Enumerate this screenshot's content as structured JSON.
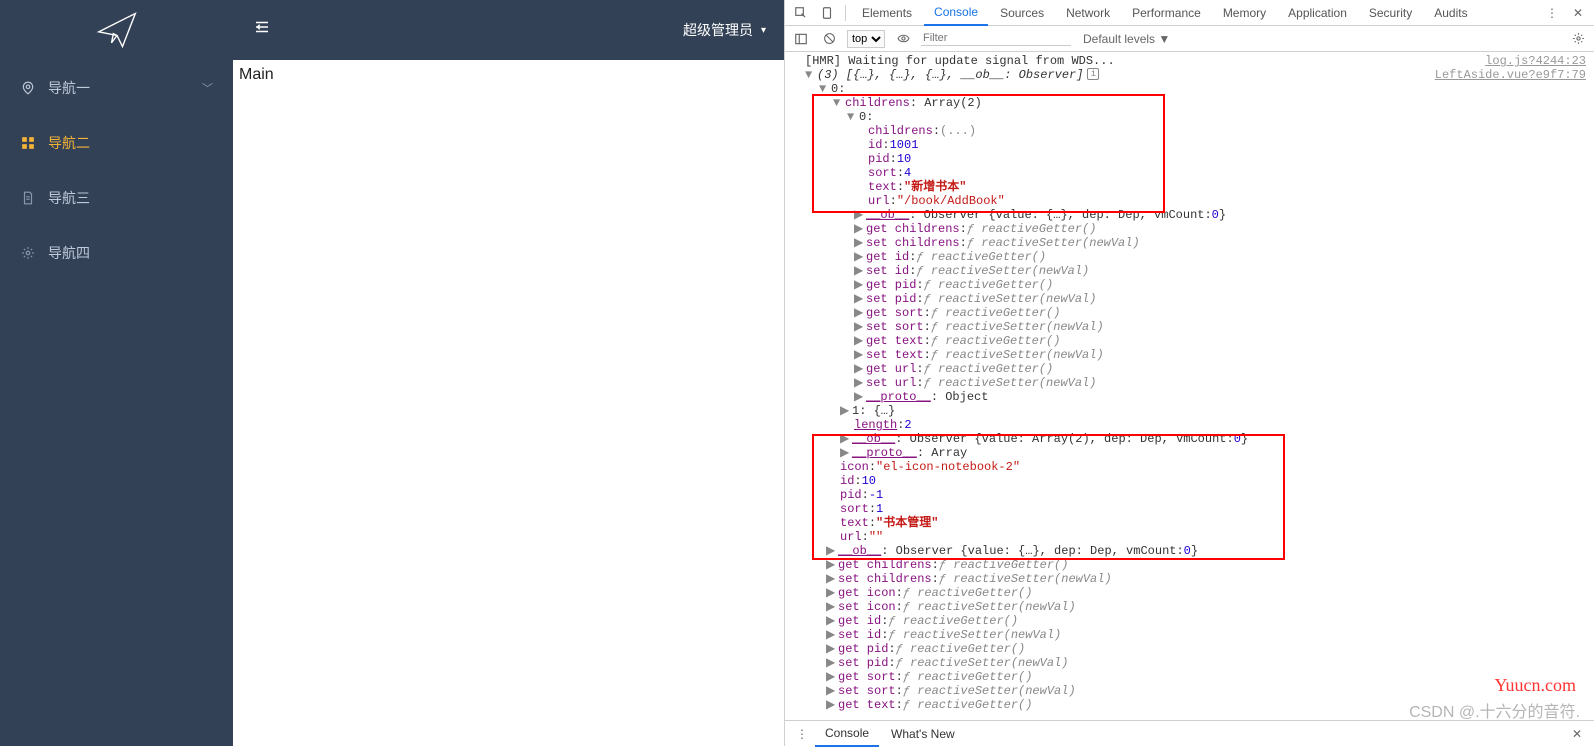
{
  "sidebar": {
    "items": [
      {
        "label": "导航一",
        "icon": "location-icon",
        "hasChildren": true
      },
      {
        "label": "导航二",
        "icon": "grid-icon",
        "active": true
      },
      {
        "label": "导航三",
        "icon": "document-icon"
      },
      {
        "label": "导航四",
        "icon": "gear-icon"
      }
    ]
  },
  "topbar": {
    "user": "超级管理员"
  },
  "main": {
    "text": "Main"
  },
  "devtools": {
    "tabs": [
      "Elements",
      "Console",
      "Sources",
      "Network",
      "Performance",
      "Memory",
      "Application",
      "Security",
      "Audits"
    ],
    "activeTab": "Console",
    "context": "top",
    "filterPlaceholder": "Filter",
    "levels": "Default levels ▼",
    "drawerTabs": [
      "Console",
      "What's New"
    ],
    "drawerActive": "Console"
  },
  "console": {
    "hmr": "[HMR] Waiting for update signal from WDS...",
    "hmrSrc": "log.js?4244:23",
    "arrSummary": "(3) [{…}, {…}, {…}, __ob__: Observer]",
    "arrSrc": "LeftAside.vue?e9f7:79",
    "idx0": "0:",
    "childrensArr": "childrens: Array(2)",
    "innerIdx0": "0:",
    "childrensEllipsis": "childrens: (...)",
    "id1001_key": "id: ",
    "id1001_val": "1001",
    "pid10_key": "pid: ",
    "pid10_val": "10",
    "sort4_key": "sort: ",
    "sort4_val": "4",
    "text_key": "text: ",
    "text_xinzeng": "\"新增书本\"",
    "url_key": "url: ",
    "url_addbook": "\"/book/AddBook\"",
    "ob_observer_line": "__ob__: Observer {value: {…}, dep: Dep, vmCount: 0}",
    "get_childrens": "get childrens: ƒ reactiveGetter()",
    "set_childrens": "set childrens: ƒ reactiveSetter(newVal)",
    "get_id": "get id: ƒ reactiveGetter()",
    "set_id": "set id: ƒ reactiveSetter(newVal)",
    "get_pid": "get pid: ƒ reactiveGetter()",
    "set_pid": "set pid: ƒ reactiveSetter(newVal)",
    "get_sort": "get sort: ƒ reactiveGetter()",
    "set_sort": "set sort: ƒ reactiveSetter(newVal)",
    "get_text": "get text: ƒ reactiveGetter()",
    "set_text": "set text: ƒ reactiveSetter(newVal)",
    "get_url": "get url: ƒ reactiveGetter()",
    "set_url": "set url: ƒ reactiveSetter(newVal)",
    "proto_obj": "__proto__: Object",
    "one_brace": "1: {…}",
    "length2_key": "length: ",
    "length2_val": "2",
    "ob_observer_arr": "__ob__: Observer {value: Array(2), dep: Dep, vmCount: 0}",
    "proto_arr": "__proto__: Array",
    "icon_key": "icon: ",
    "icon_val": "\"el-icon-notebook-2\"",
    "id10_key": "id: ",
    "id10_val": "10",
    "pidn1_key": "pid: ",
    "pidn1_val": "-1",
    "sort1_key": "sort: ",
    "sort1_val": "1",
    "text2_key": "text: ",
    "text_shuben": "\"书本管理\"",
    "url_empty_key": "url: ",
    "url_empty_val": "\"\"",
    "ob_observer_line2": "__ob__: Observer {value: {…}, dep: Dep, vmCount: 0}",
    "get_childrens2": "get childrens: ƒ reactiveGetter()",
    "set_childrens2": "set childrens: ƒ reactiveSetter(newVal)",
    "get_icon": "get icon: ƒ reactiveGetter()",
    "set_icon": "set icon: ƒ reactiveSetter(newVal)",
    "get_id2": "get id: ƒ reactiveGetter()",
    "set_id2": "set id: ƒ reactiveSetter(newVal)",
    "get_pid2": "get pid: ƒ reactiveGetter()",
    "set_pid2": "set pid: ƒ reactiveSetter(newVal)",
    "get_sort2": "get sort: ƒ reactiveGetter()",
    "set_sort2": "set sort: ƒ reactiveSetter(newVal)",
    "get_text2": "get text: ƒ reactiveGetter()"
  },
  "watermark": {
    "w1": "Yuucn.com",
    "w2": "CSDN @.十六分的音符."
  }
}
